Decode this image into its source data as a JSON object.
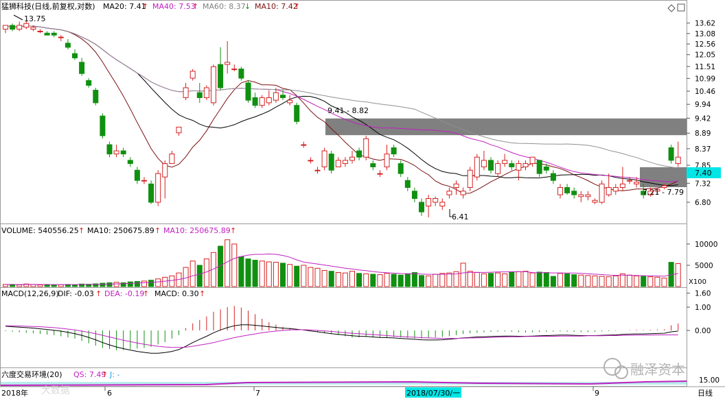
{
  "header": {
    "stock_title": "猛狮科技(日线,前复权,对数)",
    "ma20": "MA20: 7.41",
    "ma40": "MA40: 7.53",
    "ma60": "MA60: 8.37",
    "ma10": "MA10: 7.42",
    "arrow_up": "↑",
    "arrow_down": "↓"
  },
  "volume_header": {
    "volume": "VOLUME: 540556.25",
    "ma10_a": "MA10: 250675.89",
    "ma10_b": "MA10: 250675.89"
  },
  "macd_header": {
    "params": "MACD(12,26,9)",
    "dif": "DIF: -0.03",
    "dea": "DEA: -0.19",
    "macd": "MACD: 0.30"
  },
  "ind_header": {
    "name": "六度交易环境(20)",
    "qs": "QS: 7.49",
    "j": "J: -"
  },
  "price_axis": [
    "13.62",
    "13.08",
    "12.56",
    "12.05",
    "11.51",
    "10.99",
    "10.46",
    "9.94",
    "9.42",
    "8.89",
    "8.37",
    "7.85",
    "7.32",
    "6.80"
  ],
  "volume_axis": [
    "10000",
    "5000"
  ],
  "volume_unit": "X100",
  "macd_axis": [
    "1.60",
    "1.00",
    "0.00"
  ],
  "ind_axis": [
    "15.00"
  ],
  "current_price": "7.40",
  "annotations": {
    "high": "13.75",
    "low": "6.41",
    "zone_upper": "9.41 - 8.82",
    "zone_lower": "7.21 - 7.79"
  },
  "x_axis": {
    "year": "2018年",
    "m6": "6",
    "m7": "7",
    "cursor_date": "2018/07/30/一",
    "m9": "9",
    "period": "日线"
  },
  "watermarks": {
    "left": "大数据",
    "right": "融泽资本"
  },
  "colors": {
    "up": "#d62020",
    "down": "#109010",
    "ma_black": "#000000",
    "ma_magenta": "#c020c0",
    "ma_gray": "#909090",
    "ma_red": "#7a1010",
    "zone": "#808080",
    "cursor": "#00e5e5"
  },
  "chart_data": {
    "type": "candlestick",
    "price_scale": "log",
    "ylim": [
      6.5,
      13.9
    ],
    "candles": [
      [
        13.3,
        13.5,
        13.1,
        13.5
      ],
      [
        13.5,
        13.6,
        13.2,
        13.3
      ],
      [
        13.3,
        13.7,
        13.2,
        13.5
      ],
      [
        13.4,
        13.75,
        13.3,
        13.6
      ],
      [
        13.3,
        13.5,
        13.2,
        13.4
      ],
      [
        13.2,
        13.3,
        13.1,
        13.2
      ],
      [
        13.1,
        13.2,
        13.0,
        13.0
      ],
      [
        13.1,
        13.2,
        12.9,
        13.0
      ],
      [
        12.9,
        13.0,
        12.7,
        12.9
      ],
      [
        12.6,
        12.8,
        12.3,
        12.4
      ],
      [
        12.1,
        12.3,
        11.8,
        11.9
      ],
      [
        11.7,
        11.9,
        11.1,
        11.2
      ],
      [
        10.9,
        11.0,
        10.6,
        10.7
      ],
      [
        10.5,
        10.6,
        9.9,
        10.0
      ],
      [
        9.5,
        9.6,
        8.7,
        8.8
      ],
      [
        8.5,
        8.6,
        8.1,
        8.2
      ],
      [
        8.2,
        8.5,
        8.1,
        8.3
      ],
      [
        8.3,
        8.4,
        8.1,
        8.2
      ],
      [
        8.0,
        8.1,
        7.8,
        7.9
      ],
      [
        7.7,
        7.8,
        7.3,
        7.4
      ],
      [
        7.4,
        7.5,
        7.3,
        7.4
      ],
      [
        7.3,
        7.4,
        6.75,
        6.8
      ],
      [
        6.8,
        7.7,
        6.7,
        7.6
      ],
      [
        7.5,
        8.0,
        6.9,
        7.9
      ],
      [
        7.9,
        8.3,
        7.9,
        8.2
      ],
      [
        8.9,
        9.1,
        8.8,
        9.1
      ],
      [
        10.2,
        10.8,
        10.1,
        10.6
      ],
      [
        11.0,
        11.4,
        10.9,
        11.3
      ],
      [
        10.4,
        10.8,
        10.0,
        10.2
      ],
      [
        10.2,
        10.7,
        10.1,
        10.6
      ],
      [
        10.0,
        11.6,
        9.9,
        11.5
      ],
      [
        11.6,
        12.4,
        10.5,
        10.6
      ],
      [
        11.6,
        12.7,
        11.2,
        11.7
      ],
      [
        11.4,
        11.6,
        11.3,
        11.4
      ],
      [
        11.4,
        11.5,
        10.9,
        11.0
      ],
      [
        10.8,
        10.9,
        10.0,
        10.1
      ],
      [
        10.2,
        10.4,
        9.8,
        9.9
      ],
      [
        9.9,
        10.3,
        9.8,
        10.2
      ],
      [
        10.0,
        10.5,
        9.9,
        10.2
      ],
      [
        10.1,
        10.6,
        10.0,
        10.4
      ],
      [
        10.3,
        10.5,
        10.1,
        10.2
      ],
      [
        10.0,
        10.3,
        9.9,
        10.1
      ],
      [
        9.9,
        10.0,
        9.2,
        9.3
      ],
      [
        8.5,
        8.6,
        8.4,
        8.5
      ],
      [
        8.0,
        8.1,
        7.9,
        8.0
      ],
      [
        7.7,
        7.8,
        7.6,
        7.7
      ],
      [
        7.8,
        8.4,
        7.7,
        8.3
      ],
      [
        8.2,
        8.3,
        7.6,
        7.7
      ],
      [
        7.8,
        8.1,
        7.8,
        8.0
      ],
      [
        7.9,
        8.1,
        7.8,
        8.0
      ],
      [
        8.0,
        8.3,
        7.9,
        8.1
      ],
      [
        8.3,
        8.4,
        8.0,
        8.1
      ],
      [
        8.1,
        8.8,
        8.0,
        8.7
      ],
      [
        7.9,
        8.0,
        7.7,
        7.8
      ],
      [
        7.6,
        7.7,
        7.5,
        7.6
      ],
      [
        7.8,
        8.5,
        7.7,
        8.2
      ],
      [
        8.4,
        8.5,
        8.1,
        8.2
      ],
      [
        7.9,
        8.0,
        7.5,
        7.6
      ],
      [
        7.4,
        7.5,
        7.1,
        7.2
      ],
      [
        7.1,
        7.2,
        6.8,
        6.9
      ],
      [
        6.8,
        6.9,
        6.45,
        6.55
      ],
      [
        6.7,
        7.0,
        6.41,
        6.9
      ],
      [
        6.8,
        6.95,
        6.7,
        6.9
      ],
      [
        6.7,
        6.9,
        6.6,
        6.8
      ],
      [
        7.0,
        7.2,
        6.9,
        7.1
      ],
      [
        7.2,
        7.4,
        7.0,
        7.3
      ],
      [
        7.0,
        7.2,
        6.9,
        7.1
      ],
      [
        7.2,
        7.8,
        7.1,
        7.7
      ],
      [
        7.5,
        8.2,
        7.4,
        8.1
      ],
      [
        7.8,
        8.3,
        7.7,
        8.0
      ],
      [
        8.0,
        8.1,
        7.6,
        7.7
      ],
      [
        7.6,
        8.0,
        7.5,
        7.9
      ],
      [
        7.9,
        8.2,
        7.8,
        8.0
      ],
      [
        7.9,
        8.0,
        7.7,
        7.8
      ],
      [
        7.7,
        8.0,
        7.4,
        7.9
      ],
      [
        7.8,
        8.0,
        7.7,
        7.9
      ],
      [
        7.9,
        8.1,
        7.8,
        8.1
      ],
      [
        8.0,
        8.0,
        7.5,
        7.6
      ],
      [
        7.8,
        7.9,
        7.6,
        7.7
      ],
      [
        7.6,
        7.7,
        7.3,
        7.4
      ],
      [
        7.0,
        7.3,
        6.9,
        7.2
      ],
      [
        7.2,
        7.3,
        7.0,
        7.05
      ],
      [
        7.1,
        7.2,
        6.9,
        7.0
      ],
      [
        6.95,
        7.1,
        6.8,
        7.0
      ],
      [
        6.95,
        7.1,
        6.85,
        7.0
      ],
      [
        6.8,
        6.9,
        6.75,
        6.85
      ],
      [
        6.8,
        7.4,
        6.75,
        7.3
      ],
      [
        7.0,
        7.6,
        6.95,
        7.2
      ],
      [
        7.1,
        7.3,
        7.0,
        7.2
      ],
      [
        7.2,
        7.8,
        7.1,
        7.3
      ],
      [
        7.4,
        7.5,
        7.3,
        7.4
      ],
      [
        7.3,
        7.5,
        7.2,
        7.35
      ],
      [
        7.1,
        7.3,
        6.9,
        7.0
      ],
      [
        7.0,
        7.2,
        6.95,
        7.1
      ],
      [
        7.1,
        7.2,
        7.0,
        7.15
      ],
      [
        7.2,
        7.3,
        7.15,
        7.25
      ],
      [
        8.4,
        8.5,
        7.9,
        8.0
      ],
      [
        7.9,
        8.6,
        7.8,
        8.1
      ]
    ],
    "volumes": [
      500,
      500,
      400,
      600,
      500,
      400,
      500,
      400,
      450,
      500,
      450,
      600,
      550,
      650,
      800,
      900,
      1000,
      900,
      1100,
      1200,
      1300,
      1500,
      1800,
      2200,
      2500,
      3200,
      4500,
      6000,
      5000,
      6500,
      8000,
      9500,
      11000,
      10000,
      7000,
      6500,
      6200,
      6000,
      5800,
      5700,
      5500,
      5200,
      4800,
      5000,
      4500,
      4300,
      3800,
      3600,
      3300,
      3200,
      3600,
      3100,
      3000,
      2900,
      2800,
      3100,
      2900,
      2700,
      3000,
      3300,
      2600,
      2500,
      2900,
      3100,
      3200,
      3500,
      5500,
      3600,
      3300,
      3000,
      3100,
      3200,
      3000,
      3400,
      3500,
      3600,
      3200,
      3400,
      3300,
      2400,
      3100,
      3000,
      2800,
      2700,
      2600,
      2500,
      2400,
      2300,
      2500,
      3000,
      2700,
      2500,
      2400,
      2300,
      2200,
      2000,
      5700,
      5400
    ],
    "macd_hist": [
      -0.03,
      -0.05,
      -0.08,
      -0.1,
      -0.12,
      -0.15,
      -0.18,
      -0.2,
      -0.25,
      -0.3,
      -0.35,
      -0.45,
      -0.55,
      -0.65,
      -0.75,
      -0.8,
      -0.85,
      -0.85,
      -0.8,
      -0.78,
      -0.75,
      -0.7,
      -0.6,
      -0.5,
      -0.35,
      -0.2,
      0.1,
      0.3,
      0.45,
      0.6,
      0.8,
      0.9,
      1.0,
      1.05,
      0.98,
      0.85,
      0.7,
      0.5,
      0.35,
      0.25,
      0.15,
      0.1,
      0.05,
      0.02,
      0.01,
      -0.05,
      -0.1,
      -0.15,
      -0.2,
      -0.25,
      -0.3,
      -0.3,
      -0.28,
      -0.3,
      -0.32,
      -0.3,
      -0.28,
      -0.3,
      -0.32,
      -0.34,
      -0.35,
      -0.33,
      -0.3,
      -0.28,
      -0.25,
      -0.2,
      -0.15,
      -0.12,
      -0.1,
      -0.08,
      -0.06,
      -0.05,
      -0.04,
      -0.06,
      -0.08,
      -0.09,
      -0.08,
      -0.07,
      -0.06,
      -0.05,
      -0.04,
      -0.05,
      -0.06,
      -0.07,
      -0.07,
      -0.06,
      -0.04,
      -0.03,
      -0.02,
      0.0,
      0.02,
      0.03,
      0.02,
      0.03,
      0.04,
      0.05,
      0.22,
      0.3
    ],
    "dif": [
      0.18,
      0.16,
      0.14,
      0.12,
      0.1,
      0.07,
      0.04,
      0.01,
      -0.03,
      -0.08,
      -0.14,
      -0.21,
      -0.3,
      -0.4,
      -0.52,
      -0.62,
      -0.71,
      -0.78,
      -0.84,
      -0.9,
      -0.94,
      -0.98,
      -0.98,
      -0.95,
      -0.9,
      -0.82,
      -0.68,
      -0.52,
      -0.38,
      -0.25,
      -0.1,
      0.02,
      0.12,
      0.2,
      0.24,
      0.24,
      0.22,
      0.19,
      0.16,
      0.13,
      0.1,
      0.08,
      0.05,
      0.02,
      -0.02,
      -0.06,
      -0.1,
      -0.14,
      -0.17,
      -0.2,
      -0.23,
      -0.25,
      -0.26,
      -0.28,
      -0.3,
      -0.31,
      -0.32,
      -0.34,
      -0.36,
      -0.38,
      -0.4,
      -0.41,
      -0.41,
      -0.4,
      -0.38,
      -0.35,
      -0.32,
      -0.3,
      -0.28,
      -0.27,
      -0.26,
      -0.25,
      -0.24,
      -0.24,
      -0.25,
      -0.25,
      -0.24,
      -0.23,
      -0.22,
      -0.21,
      -0.2,
      -0.2,
      -0.21,
      -0.22,
      -0.22,
      -0.22,
      -0.21,
      -0.2,
      -0.19,
      -0.17,
      -0.16,
      -0.15,
      -0.15,
      -0.14,
      -0.13,
      -0.12,
      -0.06,
      -0.03
    ],
    "dea": [
      0.2,
      0.2,
      0.19,
      0.18,
      0.17,
      0.16,
      0.14,
      0.12,
      0.09,
      0.06,
      0.02,
      -0.03,
      -0.08,
      -0.14,
      -0.21,
      -0.28,
      -0.35,
      -0.42,
      -0.48,
      -0.54,
      -0.59,
      -0.64,
      -0.68,
      -0.71,
      -0.73,
      -0.73,
      -0.72,
      -0.68,
      -0.63,
      -0.58,
      -0.52,
      -0.45,
      -0.38,
      -0.31,
      -0.25,
      -0.2,
      -0.15,
      -0.1,
      -0.06,
      -0.03,
      0.0,
      0.02,
      0.03,
      0.03,
      0.02,
      0.0,
      -0.02,
      -0.04,
      -0.07,
      -0.1,
      -0.12,
      -0.14,
      -0.16,
      -0.18,
      -0.2,
      -0.22,
      -0.24,
      -0.26,
      -0.28,
      -0.29,
      -0.31,
      -0.32,
      -0.33,
      -0.34,
      -0.34,
      -0.34,
      -0.33,
      -0.32,
      -0.32,
      -0.31,
      -0.3,
      -0.29,
      -0.28,
      -0.27,
      -0.27,
      -0.26,
      -0.26,
      -0.26,
      -0.25,
      -0.25,
      -0.24,
      -0.24,
      -0.24,
      -0.24,
      -0.23,
      -0.23,
      -0.23,
      -0.22,
      -0.22,
      -0.21,
      -0.21,
      -0.2,
      -0.2,
      -0.2,
      -0.19,
      -0.19,
      -0.19,
      -0.19
    ]
  }
}
